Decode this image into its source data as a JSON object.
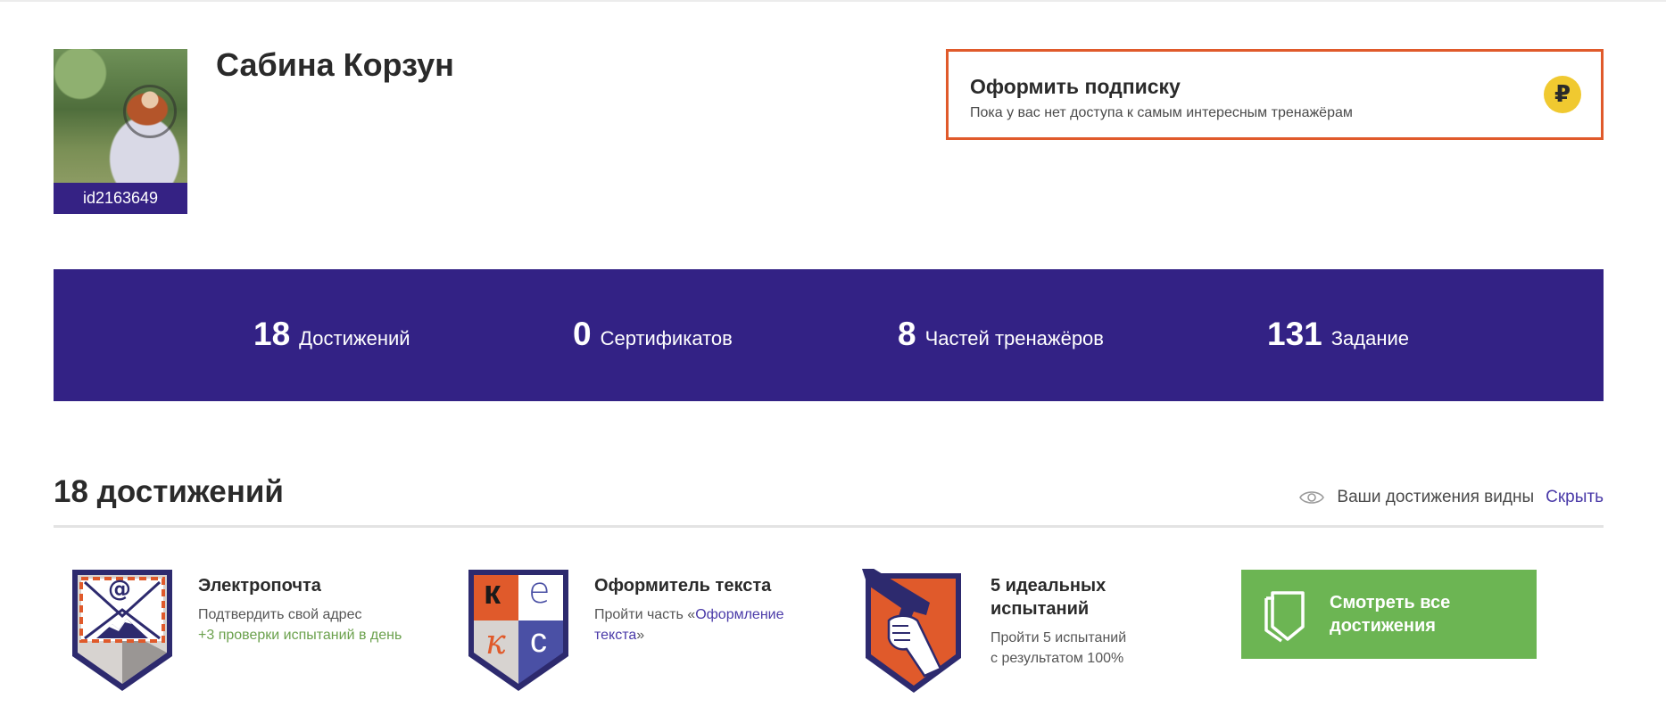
{
  "profile": {
    "name": "Сабина Корзун",
    "id_label": "id2163649"
  },
  "subscription": {
    "title": "Оформить подписку",
    "description": "Пока у вас нет доступа к самым интересным тренажёрам",
    "icon": "ruble-coin-icon",
    "icon_glyph": "₽"
  },
  "stats": [
    {
      "value": "18",
      "label": "Достижений"
    },
    {
      "value": "0",
      "label": "Сертификатов"
    },
    {
      "value": "8",
      "label": "Частей тренажёров"
    },
    {
      "value": "131",
      "label": "Задание"
    }
  ],
  "achievements": {
    "title": "18 достижений",
    "visibility_text": "Ваши достижения видны",
    "hide_label": "Скрыть",
    "items": [
      {
        "name": "Электропочта",
        "desc_line1": "Подтвердить свой адрес",
        "desc_bonus": "+3 проверки испытаний в день",
        "icon": "email-envelope-badge-icon",
        "glyph": "@"
      },
      {
        "name": "Оформитель текста",
        "desc_prefix": "Пройти часть «",
        "desc_link": "Оформление текста",
        "desc_suffix": "»",
        "icon": "typography-kegs-badge-icon",
        "letters": [
          "к",
          "е",
          "к",
          "с"
        ]
      },
      {
        "name_line1": "5 идеальных",
        "name_line2": "испытаний",
        "desc_line1": "Пройти 5 испытаний",
        "desc_line2": "с результатом 100%",
        "icon": "hand-pistol-badge-icon"
      }
    ],
    "see_all_line1": "Смотреть все",
    "see_all_line2": "достижения"
  },
  "colors": {
    "brand_purple": "#332285",
    "accent_orange": "#e05a2b",
    "coin_yellow": "#f0c930",
    "green": "#6cb553",
    "link_purple": "#4a3aa8"
  }
}
